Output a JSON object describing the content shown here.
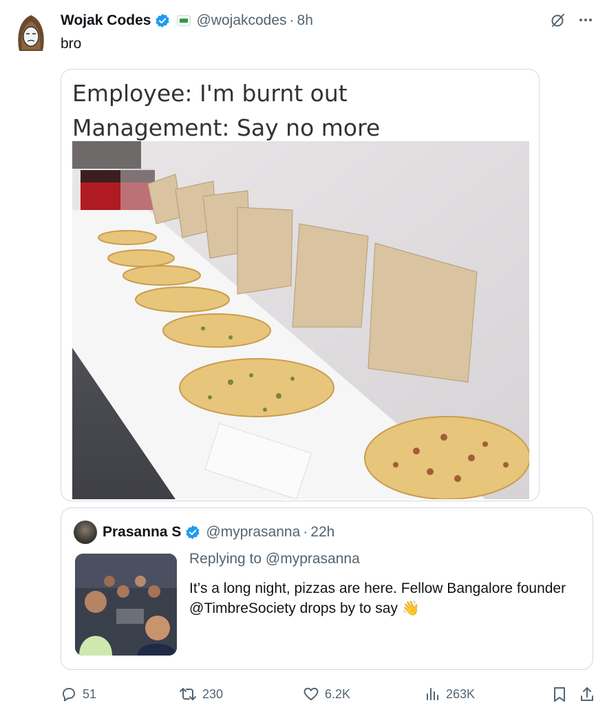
{
  "tweet": {
    "author_name": "Wojak Codes",
    "handle": "@wojakcodes",
    "separator": "·",
    "time": "8h",
    "text": "bro",
    "meme_caption_line1": "Employee: I'm burnt out",
    "meme_caption_line2": "Management: Say no more"
  },
  "quoted": {
    "author_name": "Prasanna S",
    "handle": "@myprasanna",
    "separator": "·",
    "time": "22h",
    "replying_to": "Replying to @myprasanna",
    "text": "It’s a long night, pizzas are here. Fellow Bangalore founder @TimbreSociety drops by to say 👋"
  },
  "actions": {
    "replies": "51",
    "reposts": "230",
    "likes": "6.2K",
    "views": "263K"
  },
  "colors": {
    "verified": "#1d9bf0",
    "muted_text": "#536471",
    "border": "#cfd9de"
  },
  "icons": [
    "grok-icon",
    "more-icon",
    "reply-icon",
    "repost-icon",
    "like-icon",
    "views-icon",
    "bookmark-icon",
    "share-icon",
    "verified-badge-icon"
  ]
}
